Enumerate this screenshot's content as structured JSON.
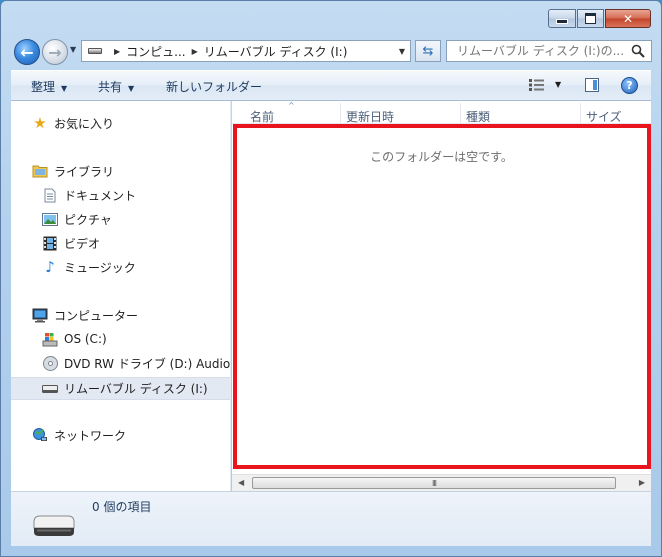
{
  "window": {
    "caption": {
      "minimize": "minimize",
      "maximize": "maximize",
      "close": "close"
    }
  },
  "address_bar": {
    "crumbs": [
      "コンピュ...",
      "リムーバブル ディスク (I:)"
    ]
  },
  "search": {
    "placeholder": "リムーバブル ディスク (I:)の..."
  },
  "toolbar": {
    "organize": "整理",
    "share": "共有",
    "new_folder": "新しいフォルダー"
  },
  "nav": {
    "favorites": "お気に入り",
    "libraries": "ライブラリ",
    "documents": "ドキュメント",
    "pictures": "ピクチャ",
    "videos": "ビデオ",
    "music": "ミュージック",
    "computer": "コンピューター",
    "os_drive": "OS (C:)",
    "dvd_drive": "DVD RW ドライブ (D:) Audio",
    "removable": "リムーバブル ディスク (I:)",
    "network": "ネットワーク"
  },
  "columns": [
    "名前",
    "更新日時",
    "種類",
    "サイズ"
  ],
  "content": {
    "empty_message": "このフォルダーは空です。"
  },
  "details": {
    "item_count": "0 個の項目"
  },
  "colors": {
    "highlight": "#e8141e",
    "accent": "#3b8be0"
  }
}
